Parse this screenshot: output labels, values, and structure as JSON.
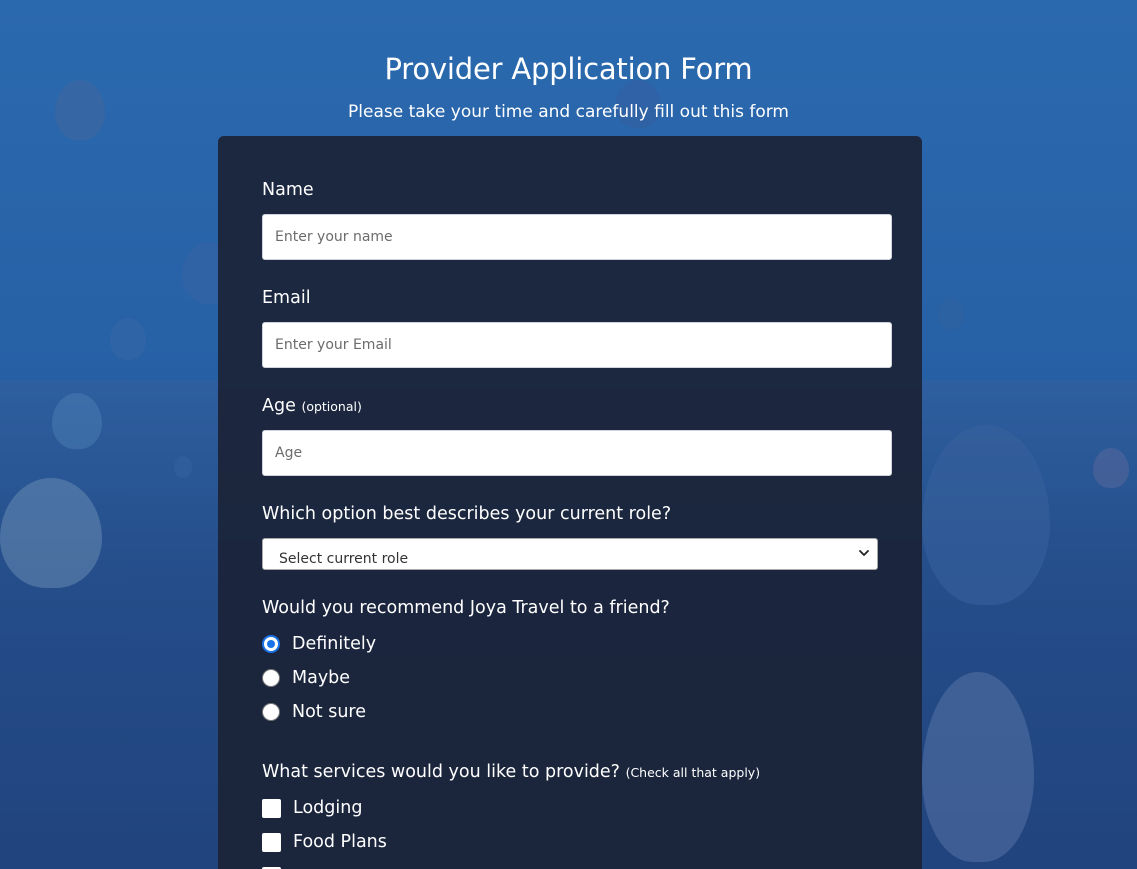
{
  "page": {
    "title": "Provider Application Form",
    "subtitle": "Please take your time and carefully fill out this form"
  },
  "form": {
    "name": {
      "label": "Name",
      "placeholder": "Enter your name",
      "value": ""
    },
    "email": {
      "label": "Email",
      "placeholder": "Enter your Email",
      "value": ""
    },
    "age": {
      "label": "Age",
      "hint": "(optional)",
      "placeholder": "Age",
      "value": ""
    },
    "role": {
      "label": "Which option best describes your current role?",
      "selected": "Select current role"
    },
    "recommend": {
      "label": "Would you recommend Joya Travel to a friend?",
      "options": [
        {
          "label": "Definitely",
          "checked": true
        },
        {
          "label": "Maybe",
          "checked": false
        },
        {
          "label": "Not sure",
          "checked": false
        }
      ]
    },
    "services": {
      "label": "What services would you like to provide?",
      "hint": "(Check all that apply)",
      "options": [
        {
          "label": "Lodging",
          "checked": false
        },
        {
          "label": "Food Plans",
          "checked": false
        }
      ]
    }
  },
  "colors": {
    "background": "#2a67a8",
    "card": "#1b2438",
    "radio_accent": "#1a73e8"
  },
  "icons": {
    "select_chevron": "chevron-down-icon"
  }
}
